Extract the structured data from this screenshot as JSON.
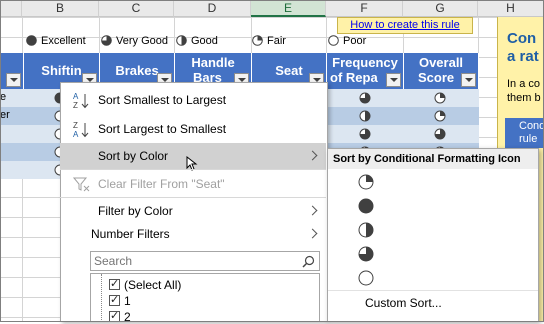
{
  "columns": [
    "B",
    "C",
    "D",
    "E",
    "F",
    "G",
    "H"
  ],
  "selected_column": "E",
  "legend": [
    {
      "label": "Excellent",
      "fill": 1.0
    },
    {
      "label": "Very Good",
      "fill": 0.75
    },
    {
      "label": "Good",
      "fill": 0.5
    },
    {
      "label": "Fair",
      "fill": 0.25
    },
    {
      "label": "Poor",
      "fill": 0.0
    }
  ],
  "link_text": "How to create this rule",
  "table_headers": {
    "shifting": "Shiftin",
    "brakes": "Brakes",
    "handlebars_1": "Handle",
    "handlebars_2": "Bars",
    "seat": "Seat",
    "freq_1": "Frequency",
    "freq_2": "of Repa",
    "overall_1": "Overall",
    "overall_2": "Score"
  },
  "row_labels": [
    "e",
    "er"
  ],
  "frequency_icons": [
    0.75,
    0.5,
    0.75,
    0.25,
    0.5
  ],
  "overall_icons": [
    0.25,
    0.25,
    0.75,
    0.25,
    0.5
  ],
  "sidebar": {
    "title_1": "Con",
    "title_2": "a rat",
    "text_1": "In a co",
    "text_2": "them b",
    "button_1": "Cond",
    "button_2": "rule"
  },
  "filter_menu": {
    "sort_asc": "Sort Smallest to Largest",
    "sort_desc": "Sort Largest to Smallest",
    "sort_by_color": "Sort by Color",
    "clear_filter": "Clear Filter From \"Seat\"",
    "filter_by_color": "Filter by Color",
    "number_filters": "Number Filters",
    "search_placeholder": "Search",
    "list_items": [
      "(Select All)",
      "1",
      "2"
    ]
  },
  "submenu": {
    "header": "Sort by Conditional Formatting Icon",
    "icons": [
      {
        "name": "quarter-circle",
        "fill": 0.25
      },
      {
        "name": "full-circle",
        "fill": 1.0
      },
      {
        "name": "half-circle",
        "fill": 0.5
      },
      {
        "name": "three-quarter-circle",
        "fill": 0.75
      },
      {
        "name": "empty-circle",
        "fill": 0.0
      }
    ],
    "custom_sort": "Custom Sort..."
  },
  "colors": {
    "table_header": "#4472c4",
    "band_light": "#dce6f1",
    "band_dark": "#b8cce4",
    "sidebar": "#fff2a8",
    "selected_column": "#217346"
  }
}
